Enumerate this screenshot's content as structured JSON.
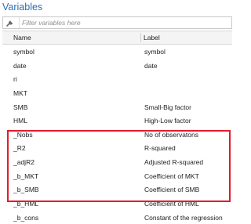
{
  "panel": {
    "title": "Variables"
  },
  "filter": {
    "placeholder": "Filter variables here",
    "value": "",
    "icon": "wrench-icon"
  },
  "columns": {
    "name": "Name",
    "label": "Label"
  },
  "rows": [
    {
      "name": "symbol",
      "label": "symbol"
    },
    {
      "name": "date",
      "label": "date"
    },
    {
      "name": "ri",
      "label": ""
    },
    {
      "name": "MKT",
      "label": ""
    },
    {
      "name": "SMB",
      "label": "Small-Big factor"
    },
    {
      "name": "HML",
      "label": "High-Low factor"
    },
    {
      "name": "_Nobs",
      "label": "No of observatons"
    },
    {
      "name": "_R2",
      "label": "R-squared"
    },
    {
      "name": "_adjR2",
      "label": "Adjusted R-squared"
    },
    {
      "name": "_b_MKT",
      "label": "Coefficient of MKT"
    },
    {
      "name": "_b_SMB",
      "label": "Coefficient of SMB"
    },
    {
      "name": "_b_HML",
      "label": "Coefficient of HML"
    },
    {
      "name": "_b_cons",
      "label": "Constant of the regression"
    }
  ],
  "colors": {
    "title": "#2e6db4",
    "highlight": "#e41b2c"
  }
}
